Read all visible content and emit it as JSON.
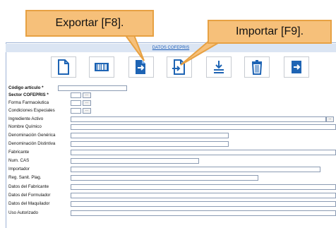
{
  "callouts": {
    "export_label": "Exportar [F8].",
    "import_label": "Importar [F9]."
  },
  "header": {
    "title": "DATOS COFEPRIS"
  },
  "toolbar": {
    "buttons": [
      {
        "name": "new-document",
        "icon": "document-icon"
      },
      {
        "name": "barcode",
        "icon": "barcode-icon"
      },
      {
        "name": "export",
        "icon": "export-icon"
      },
      {
        "name": "import",
        "icon": "import-icon"
      },
      {
        "name": "download",
        "icon": "download-icon"
      },
      {
        "name": "delete",
        "icon": "trash-icon"
      },
      {
        "name": "exit",
        "icon": "exit-icon"
      }
    ]
  },
  "form": {
    "fields": [
      {
        "label": "Código artículo *",
        "value": ""
      },
      {
        "label": "Sector COFEPRIS *",
        "value": ""
      },
      {
        "label": "Forma Farmacéutica",
        "value": ""
      },
      {
        "label": "Condiciones Especiales",
        "value": ""
      },
      {
        "label": "Ingrediente Activo",
        "value": ""
      },
      {
        "label": "Nombre Químico",
        "value": ""
      },
      {
        "label": "Denominación Genérica",
        "value": ""
      },
      {
        "label": "Denominación Distintiva",
        "value": ""
      },
      {
        "label": "Fabricante",
        "value": ""
      },
      {
        "label": "Num. CAS",
        "value": ""
      },
      {
        "label": "Importador",
        "value": ""
      },
      {
        "label": "Reg. Sanit. Plag.",
        "value": ""
      },
      {
        "label": "Datos del Fabricante",
        "value": ""
      },
      {
        "label": "Datos del Formulador",
        "value": ""
      },
      {
        "label": "Datos del Maquilador",
        "value": ""
      },
      {
        "label": "Uso Autorizado",
        "value": ""
      }
    ],
    "ellipsis": "..."
  },
  "colors": {
    "accent": "#1f5fb8",
    "callout_bg": "#f6c07a",
    "callout_border": "#e7a143"
  }
}
